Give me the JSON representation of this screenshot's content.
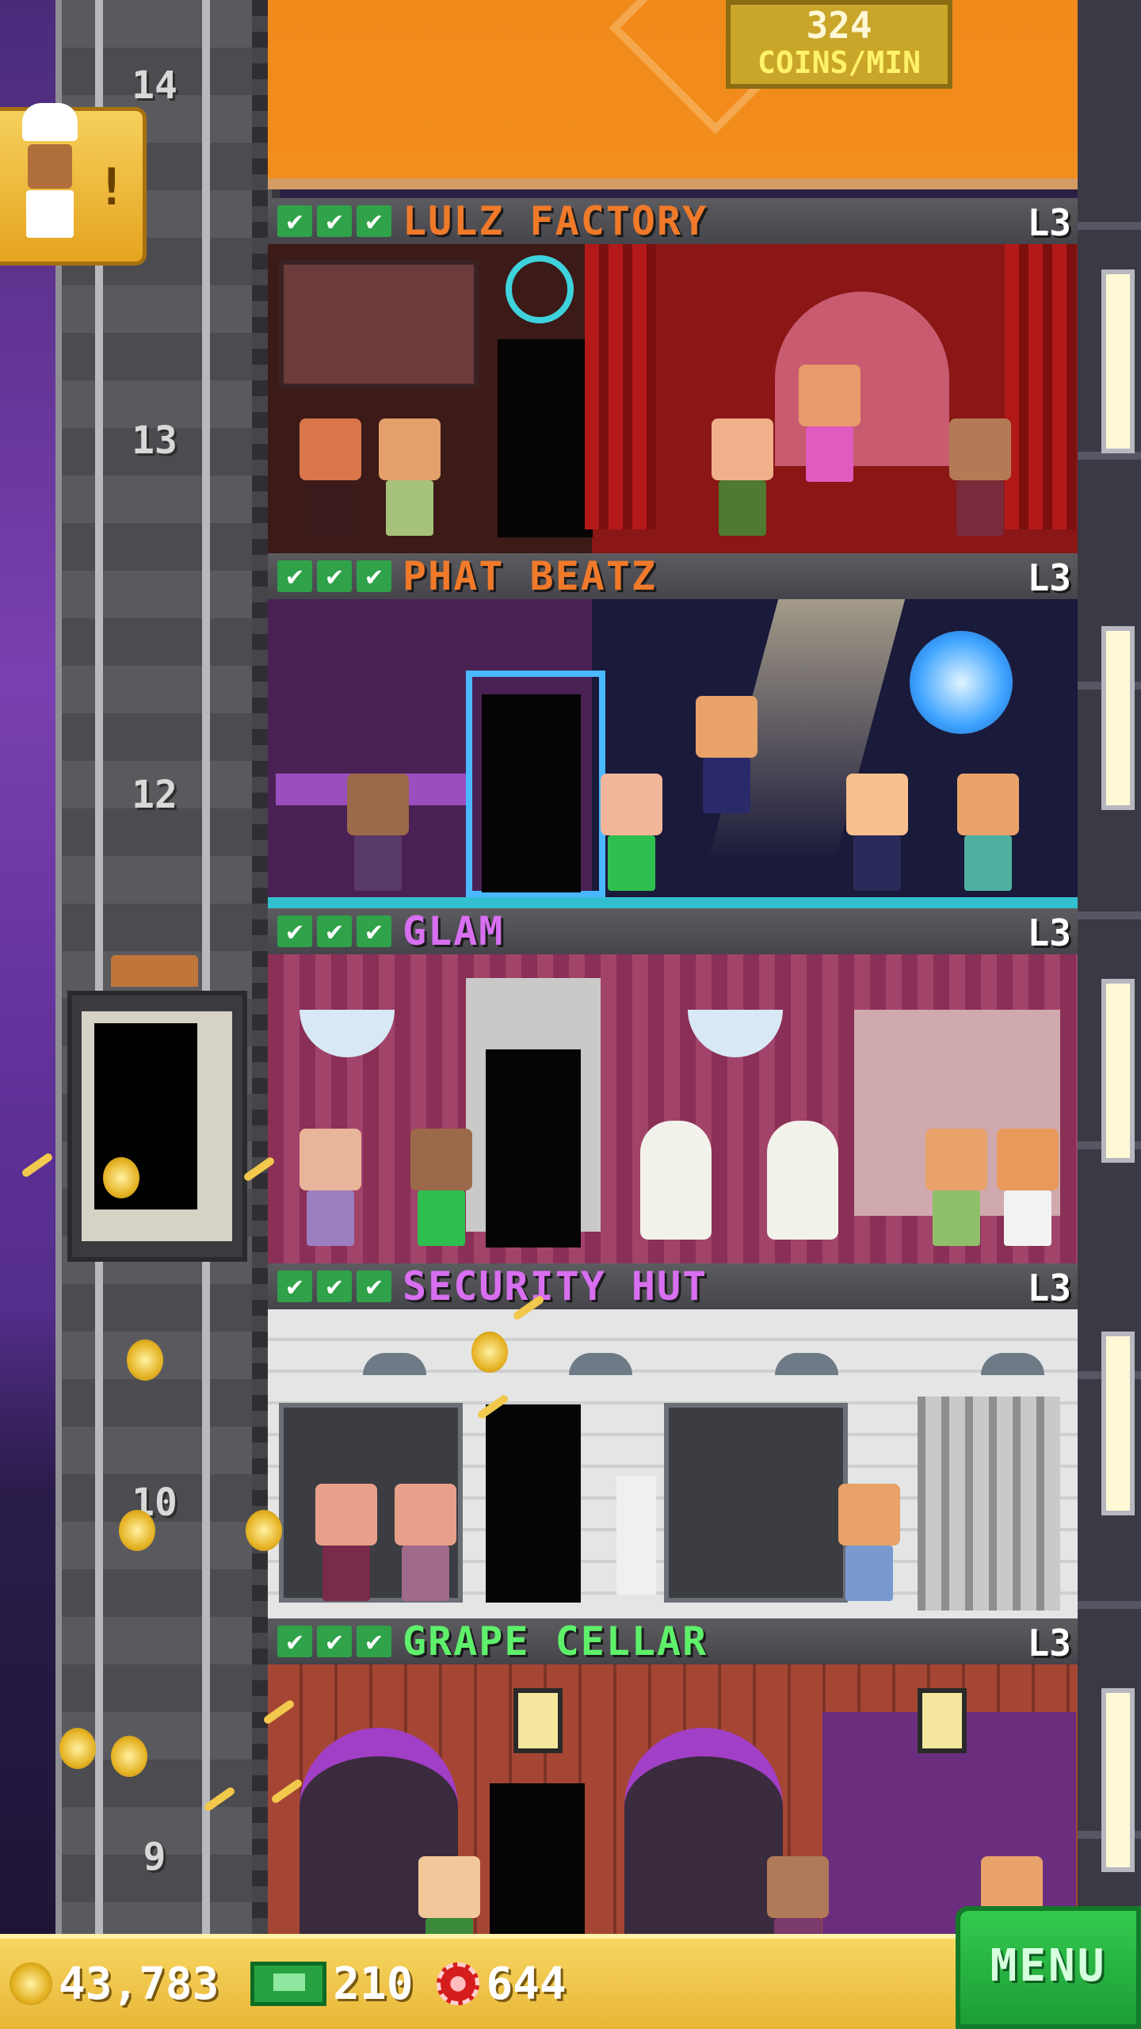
{
  "top_room": {
    "coins_per_min": "324",
    "unit_label": "COINS/MIN"
  },
  "notification": {
    "alert_glyph": "!",
    "character": "chef-icon"
  },
  "shaft": {
    "floor_numbers": [
      "14",
      "13",
      "12",
      "10",
      "9"
    ]
  },
  "floors": [
    {
      "name": "LULZ FACTORY",
      "level": "L3",
      "name_color": "#f07a2a",
      "checks": [
        "✔",
        "✔",
        "✔"
      ]
    },
    {
      "name": "PHAT BEATZ",
      "level": "L3",
      "name_color": "#f07a2a",
      "checks": [
        "✔",
        "✔",
        "✔"
      ]
    },
    {
      "name": "GLAM",
      "level": "L3",
      "name_color": "#d86ff0",
      "checks": [
        "✔",
        "✔",
        "✔"
      ]
    },
    {
      "name": "SECURITY HUT",
      "level": "L3",
      "name_color": "#d86ff0",
      "checks": [
        "✔",
        "✔",
        "✔"
      ]
    },
    {
      "name": "GRAPE CELLAR",
      "level": "L3",
      "name_color": "#5ff06b",
      "checks": [
        "✔",
        "✔",
        "✔"
      ]
    }
  ],
  "bottom_bar": {
    "coins": "43,783",
    "tower_bux": "210",
    "chips": "644",
    "menu_label": "MENU"
  },
  "colors": {
    "accent_green": "#2fa24a",
    "bar_gold": "#e8b637",
    "menu_green": "#1c9e35"
  }
}
